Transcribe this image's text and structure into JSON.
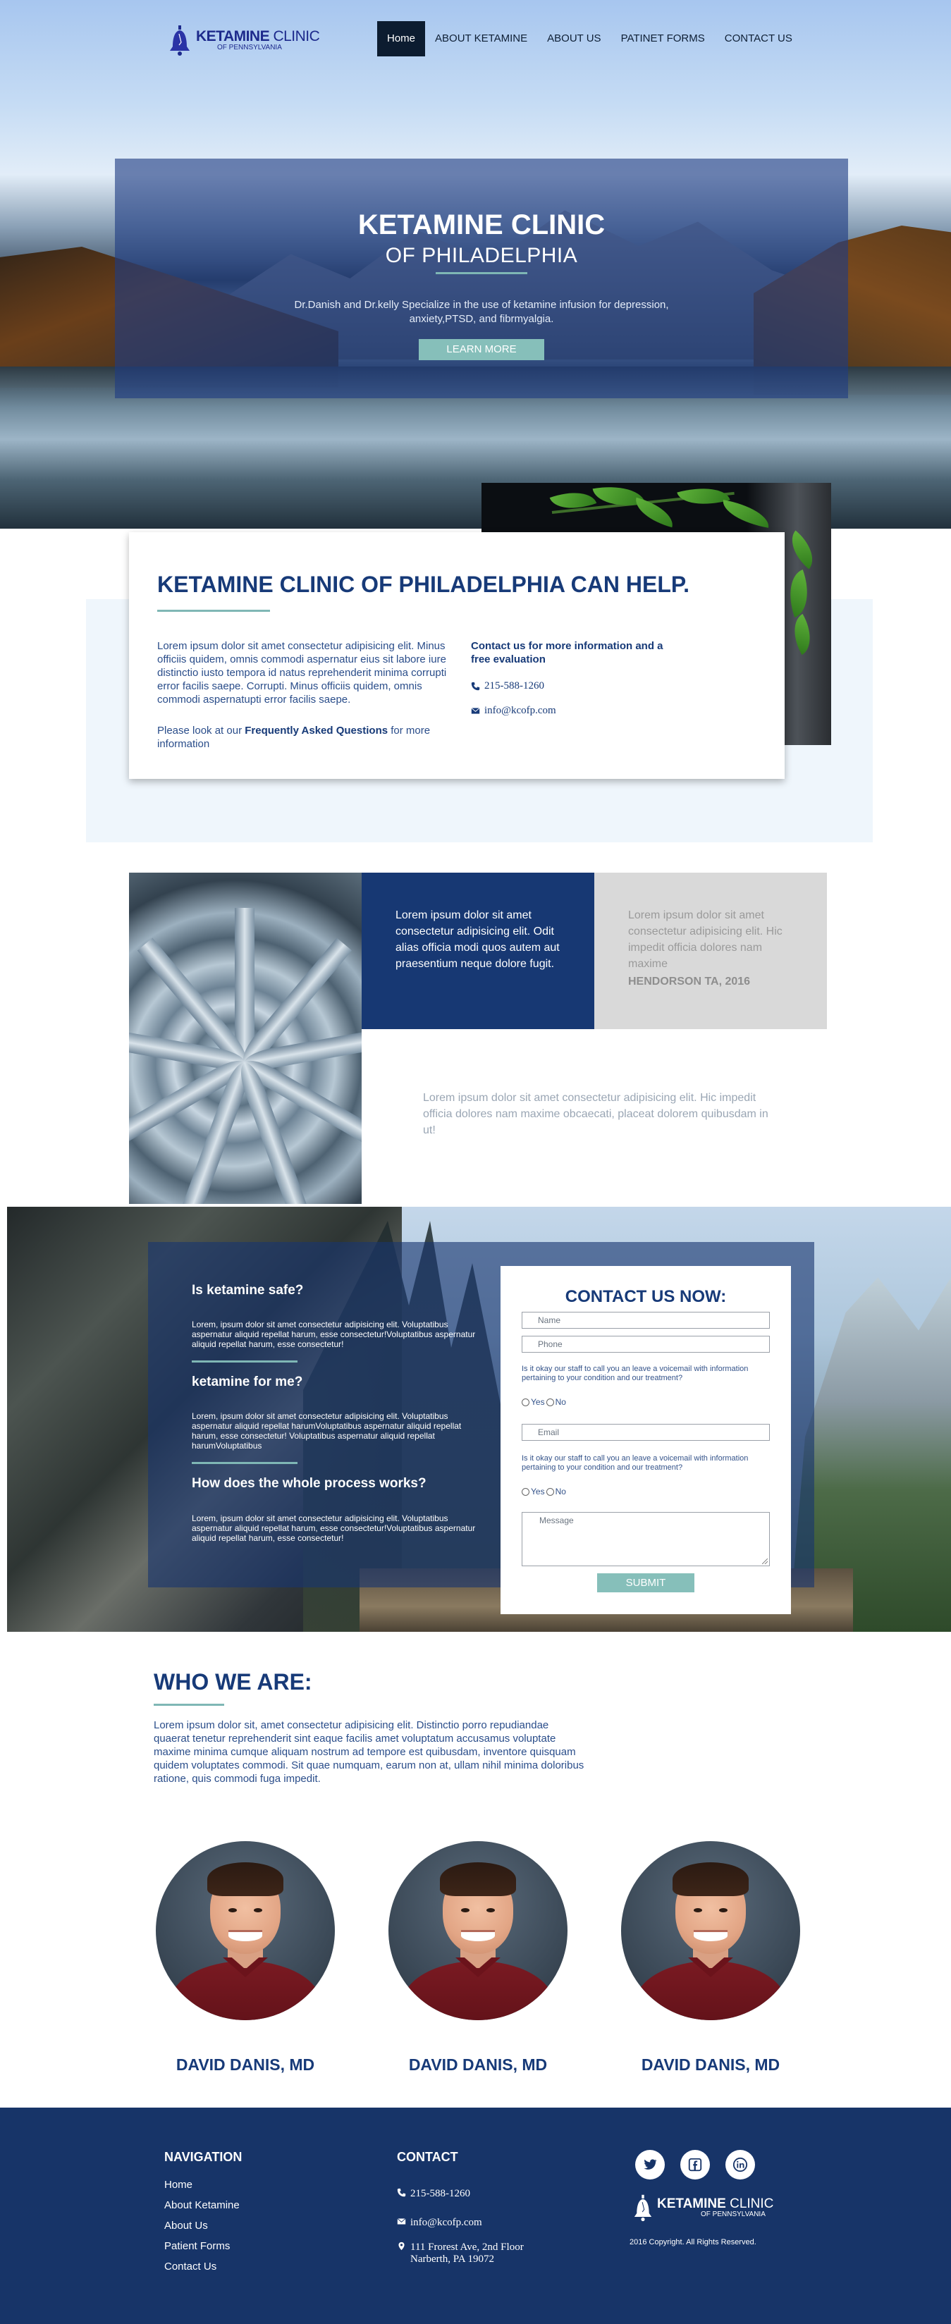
{
  "brand": {
    "name_bold": "KETAMINE",
    "name_light": " CLINIC",
    "sub": "OF PENNSYLVANIA"
  },
  "nav": {
    "items": [
      "Home",
      "ABOUT KETAMINE",
      "ABOUT US",
      "PATINET FORMS",
      "CONTACT US"
    ],
    "active": "Home"
  },
  "hero": {
    "title": "KETAMINE CLINIC",
    "subtitle": "OF PHILADELPHIA",
    "description": "Dr.Danish and Dr.kelly Specialize in the use of ketamine infusion for depression, anxiety,PTSD, and fibrmyalgia.",
    "button": "LEARN MORE"
  },
  "help": {
    "title": "KETAMINE CLINIC OF PHILADELPHIA CAN HELP.",
    "para1": "Lorem ipsum dolor sit amet consectetur adipisicing elit. Minus officiis quidem, omnis commodi aspernatur eius sit labore iure distinctio iusto tempora id natus reprehenderit minima corrupti error facilis saepe. Corrupti. Minus officiis quidem, omnis commodi aspernatupti error facilis saepe.",
    "para2_prefix": "Please look at our ",
    "para2_link": "Frequently Asked Questions",
    "para2_suffix": " for more information",
    "contact_title": "Contact us for more information and a free evaluation",
    "phone": "215-588-1260",
    "email": "info@kcofp.com"
  },
  "testimonials": {
    "dark_text": "Lorem ipsum dolor sit amet consectetur adipisicing elit. Odit alias officia modi quos autem aut praesentium neque dolore fugit.",
    "grey_text": "Lorem ipsum dolor sit amet consectetur adipisicing elit. Hic impedit officia dolores nam maxime",
    "grey_author": "HENDORSON TA, 2016",
    "plain_text": "Lorem ipsum dolor sit amet consectetur adipisicing elit. Hic impedit officia dolores nam maxime obcaecati, placeat dolorem quibusdam in ut!"
  },
  "faq": [
    {
      "q": "Is ketamine safe?",
      "a": "Lorem, ipsum dolor sit amet consectetur adipisicing elit. Voluptatibus aspernatur aliquid repellat harum, esse consectetur!Voluptatibus aspernatur aliquid repellat harum, esse consectetur!"
    },
    {
      "q": "ketamine for me?",
      "a": "Lorem, ipsum dolor sit amet consectetur adipisicing elit. Voluptatibus aspernatur aliquid repellat harumVoluptatibus aspernatur aliquid repellat harum, esse consectetur! Voluptatibus aspernatur aliquid repellat harumVoluptatibus"
    },
    {
      "q": "How does the whole process works?",
      "a": "Lorem, ipsum dolor sit amet consectetur adipisicing elit. Voluptatibus aspernatur aliquid repellat harum, esse consectetur!Voluptatibus aspernatur aliquid repellat harum, esse consectetur!"
    }
  ],
  "contact_form": {
    "title": "CONTACT US NOW:",
    "name_placeholder": "Name",
    "phone_placeholder": "Phone",
    "voicemail_note": "Is it okay our staff to call you an leave a voicemail with information pertaining to your condition and our treatment?",
    "yes": "Yes",
    "no": "No",
    "email_placeholder": "Email",
    "message_placeholder": "Message",
    "submit": "SUBMIT"
  },
  "who": {
    "title": "WHO WE ARE:",
    "text": "Lorem ipsum dolor sit, amet consectetur adipisicing elit. Distinctio porro repudiandae quaerat tenetur reprehenderit sint eaque facilis amet voluptatum accusamus voluptate maxime minima cumque aliquam nostrum ad tempore est quibusdam, inventore quisquam quidem voluptates commodi. Sit quae numquam, earum non at, ullam nihil minima doloribus ratione, quis commodi fuga impedit.",
    "doctors": [
      "DAVID DANIS, MD",
      "DAVID DANIS, MD",
      "DAVID DANIS, MD"
    ]
  },
  "footer": {
    "nav_title": "NAVIGATION",
    "nav_links": [
      "Home",
      "About Ketamine",
      "About Us",
      "Patient Forms",
      "Contact Us"
    ],
    "contact_title": "CONTACT",
    "phone": "215-588-1260",
    "email": "info@kcofp.com",
    "address_line1": "111 Frorest Ave, 2nd Floor",
    "address_line2": "Narberth, PA 19072",
    "socials": [
      "twitter-icon",
      "facebook-icon",
      "linkedin-icon"
    ],
    "copyright": "2016 Copyright. All Rights Reserved."
  }
}
